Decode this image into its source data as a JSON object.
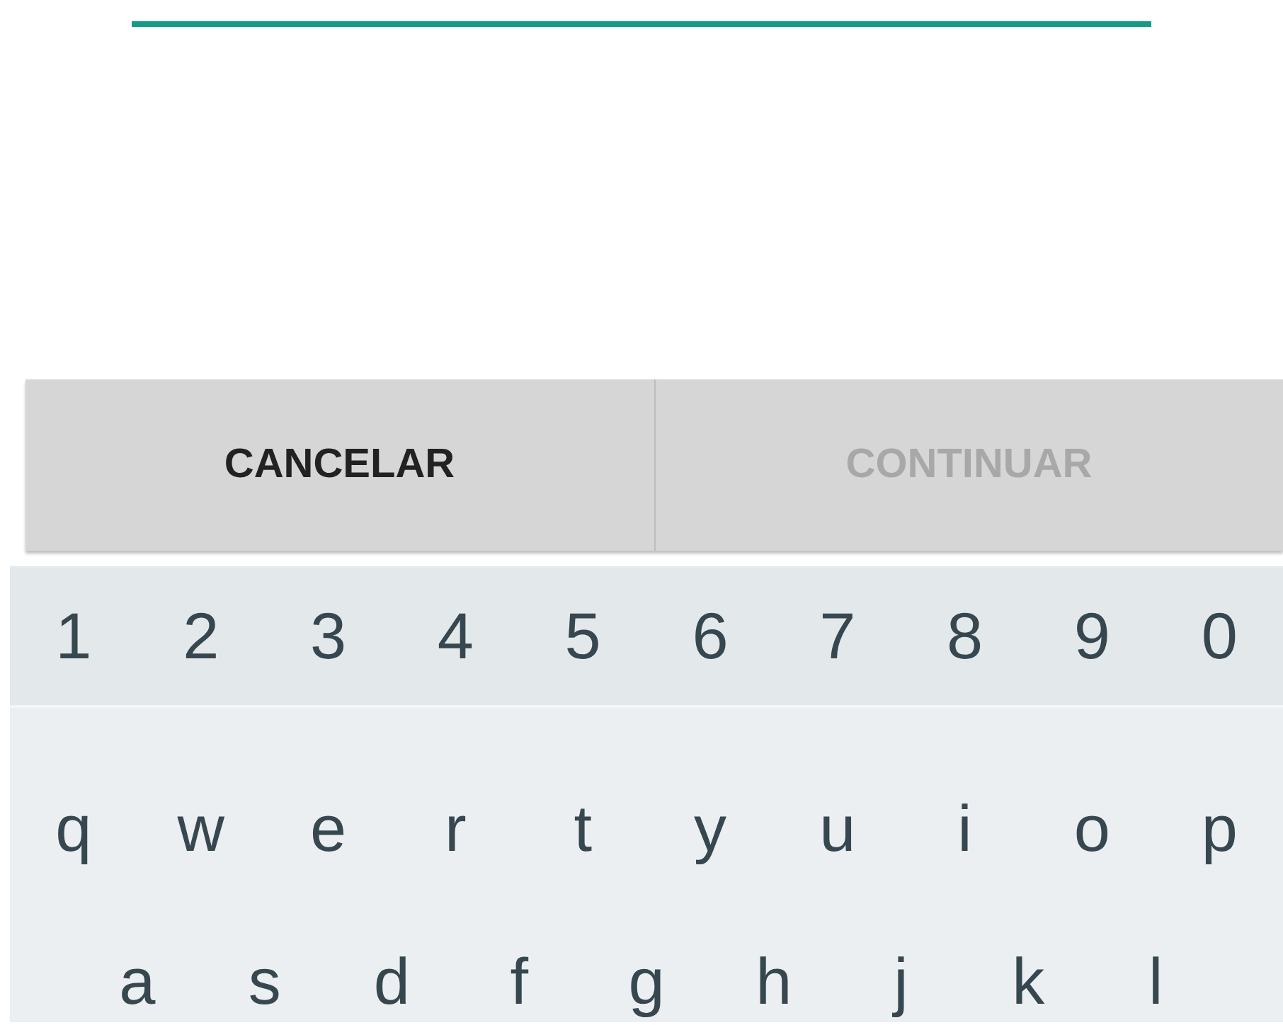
{
  "dialog_buttons": [
    {
      "label": "CANCELAR",
      "disabled": false
    },
    {
      "label": "CONTINUAR",
      "disabled": true
    }
  ],
  "keyboard": {
    "rows": [
      {
        "kind": "numbers",
        "keys": [
          "1",
          "2",
          "3",
          "4",
          "5",
          "6",
          "7",
          "8",
          "9",
          "0"
        ]
      },
      {
        "kind": "letters",
        "keys": [
          "q",
          "w",
          "e",
          "r",
          "t",
          "y",
          "u",
          "i",
          "o",
          "p"
        ]
      },
      {
        "kind": "letters-offset",
        "keys": [
          "a",
          "s",
          "d",
          "f",
          "g",
          "h",
          "j",
          "k",
          "l"
        ]
      }
    ]
  }
}
